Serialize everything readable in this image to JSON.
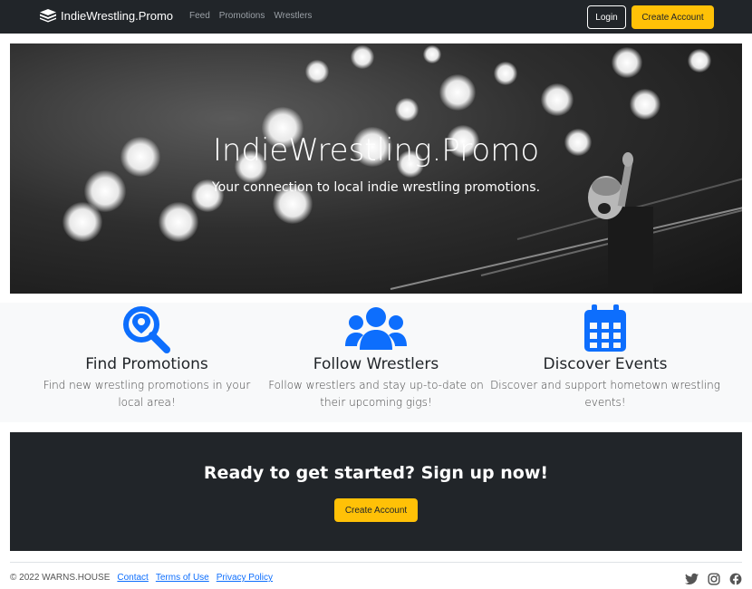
{
  "navbar": {
    "brand": "IndieWrestling.Promo",
    "links": [
      "Feed",
      "Promotions",
      "Wrestlers"
    ],
    "login_label": "Login",
    "create_account_label": "Create Account"
  },
  "hero": {
    "title": "IndieWrestling.Promo",
    "subtitle": "Your connection to local indie wrestling promotions."
  },
  "features": [
    {
      "icon": "search-location-icon",
      "title": "Find Promotions",
      "text": "Find new wrestling promotions in your local area!"
    },
    {
      "icon": "users-icon",
      "title": "Follow Wrestlers",
      "text": "Follow wrestlers and stay up-to-date on their upcoming gigs!"
    },
    {
      "icon": "calendar-icon",
      "title": "Discover Events",
      "text": "Discover and support hometown wrestling events!"
    }
  ],
  "cta": {
    "title": "Ready to get started? Sign up now!",
    "button_label": "Create Account"
  },
  "footer": {
    "copyright": "© 2022 WARNS.HOUSE",
    "links": [
      "Contact",
      "Terms of Use",
      "Privacy Policy"
    ],
    "social_icons": [
      "twitter-icon",
      "instagram-icon",
      "facebook-icon"
    ]
  },
  "colors": {
    "dark": "#212529",
    "accent": "#ffc107",
    "icon_blue": "#0d6efd",
    "light_bg": "#f8f9fa"
  }
}
